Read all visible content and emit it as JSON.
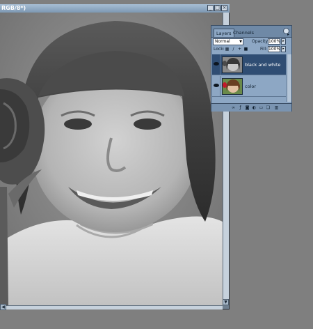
{
  "document": {
    "title": "RGB/8*)"
  },
  "layers_panel": {
    "tabs": [
      {
        "label": "Layers",
        "active": true
      },
      {
        "label": "Channels",
        "active": false
      }
    ],
    "blend_mode": "Normal",
    "opacity_label": "Opacity:",
    "opacity_value": "100%",
    "lock_label": "Lock:",
    "fill_label": "Fill:",
    "fill_value": "100%",
    "layers": [
      {
        "name": "black and white",
        "selected": true,
        "visible": true
      },
      {
        "name": "color",
        "selected": false,
        "visible": true
      }
    ]
  },
  "colors": {
    "window_frame": "#6f7f8f",
    "titlebar": "#a7bed4",
    "panel_bg": "#8da7c4",
    "selected_layer": "#2f4d73",
    "workspace": "#7f7f7f"
  }
}
